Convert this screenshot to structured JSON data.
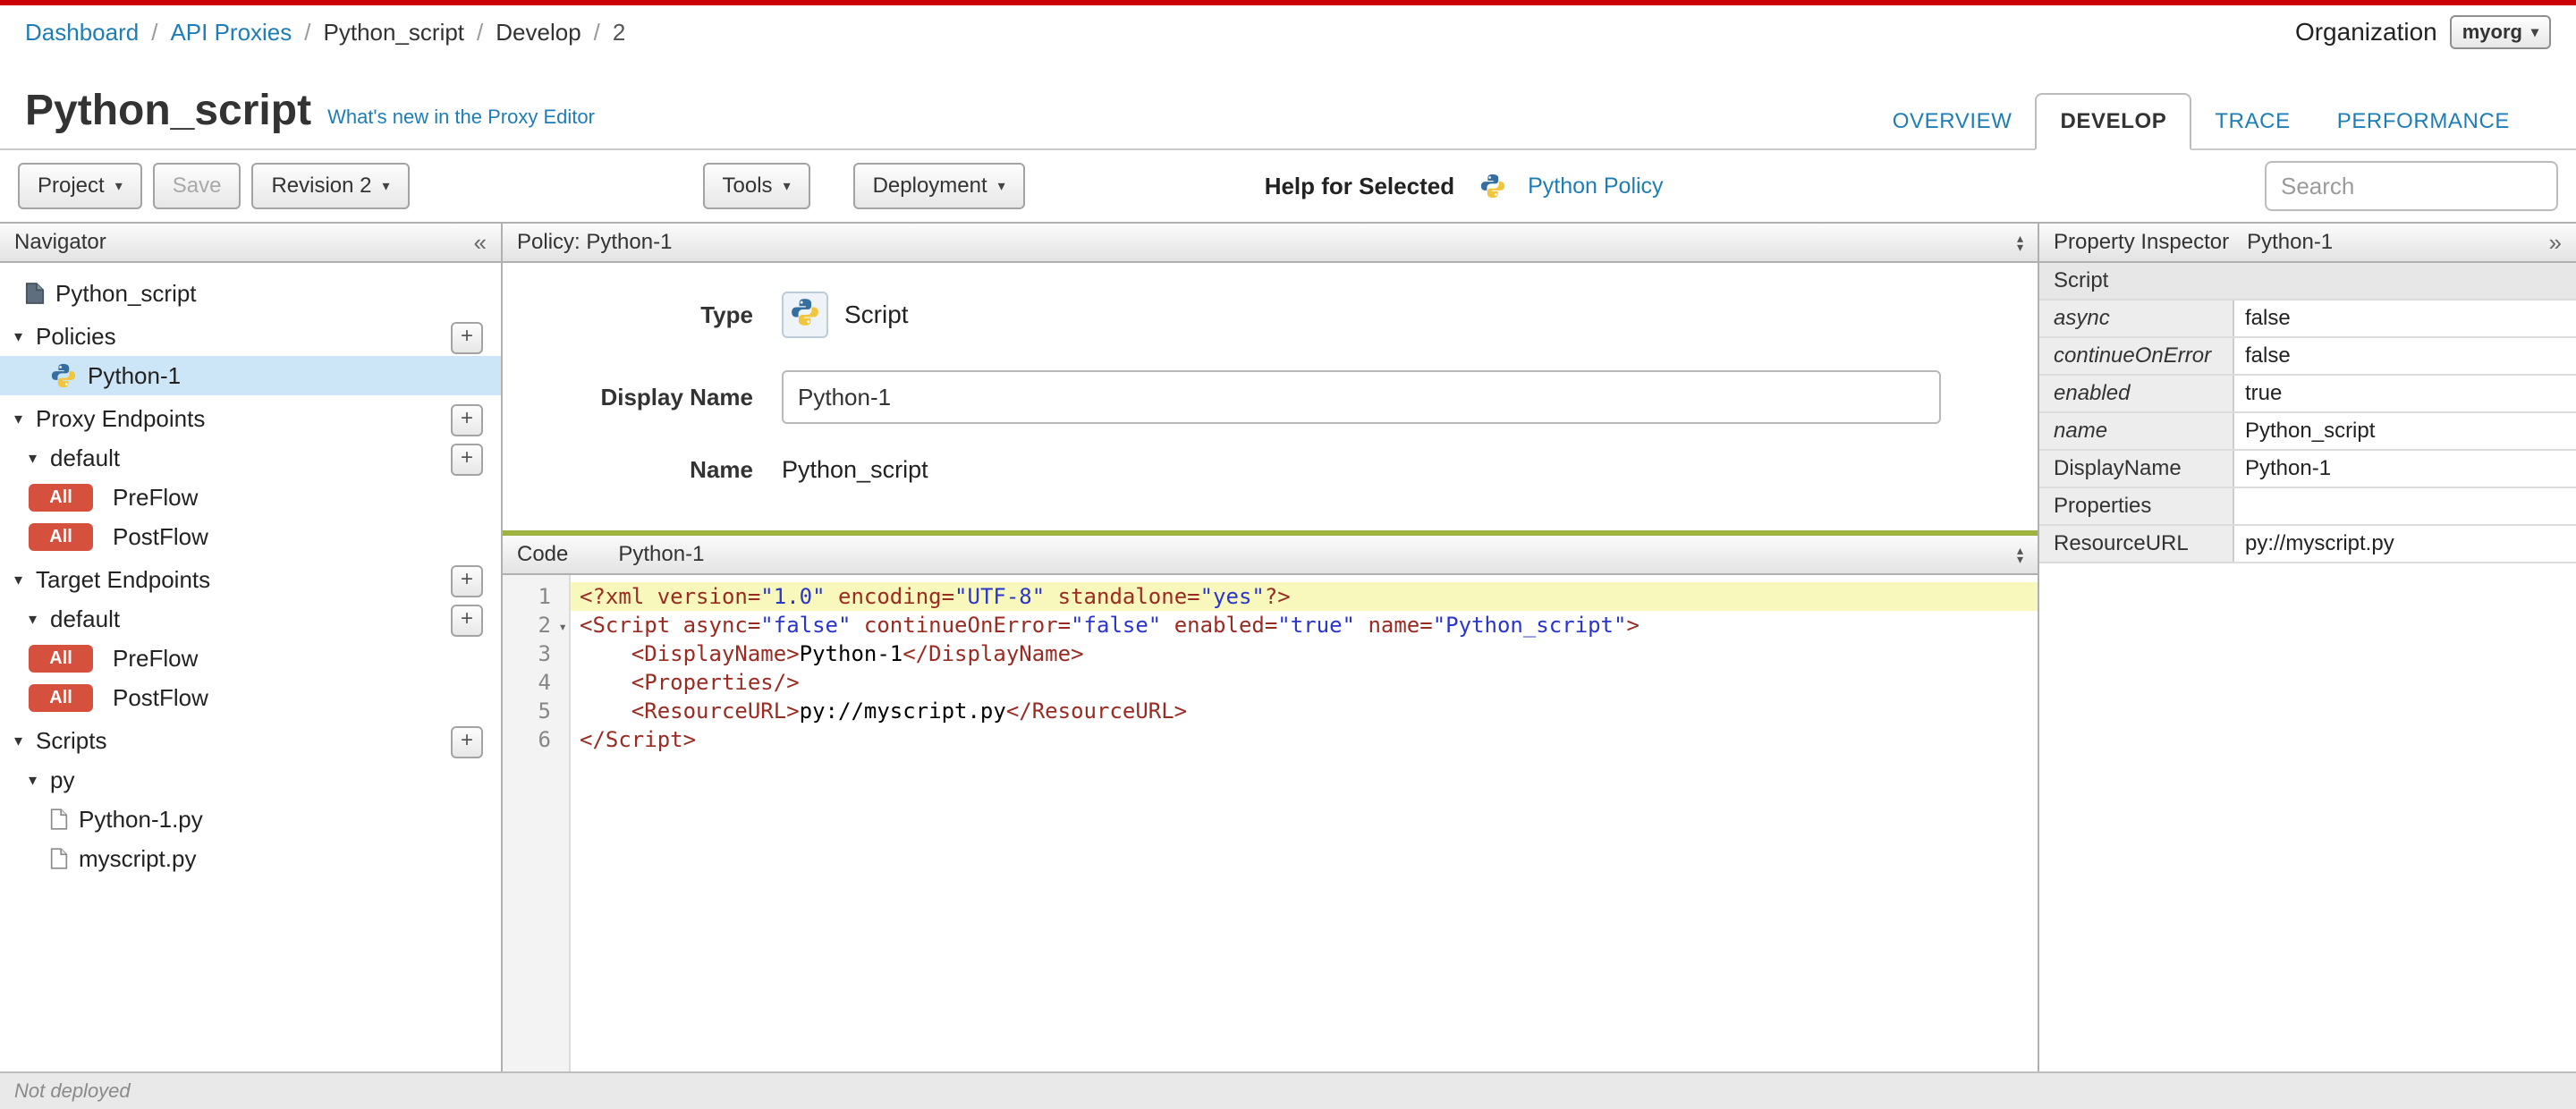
{
  "header": {
    "breadcrumb": [
      {
        "label": "Dashboard",
        "link": true
      },
      {
        "label": "API Proxies",
        "link": true
      },
      {
        "label": "Python_script",
        "link": false
      },
      {
        "label": "Develop",
        "link": false
      },
      {
        "label": "2",
        "link": false,
        "muted": true
      }
    ],
    "organization_label": "Organization",
    "organization_value": "myorg",
    "title": "Python_script",
    "whats_new_link": "What's new in the Proxy Editor",
    "tabs": [
      {
        "label": "OVERVIEW",
        "active": false
      },
      {
        "label": "DEVELOP",
        "active": true
      },
      {
        "label": "TRACE",
        "active": false
      },
      {
        "label": "PERFORMANCE",
        "active": false
      }
    ]
  },
  "toolbar": {
    "project_label": "Project",
    "save_label": "Save",
    "revision_label": "Revision 2",
    "tools_label": "Tools",
    "deployment_label": "Deployment",
    "help_for_selected_label": "Help for Selected",
    "policy_help_link": "Python Policy",
    "search_placeholder": "Search"
  },
  "navigator": {
    "title": "Navigator",
    "collapse_glyph": "«",
    "items": [
      {
        "type": "root",
        "icon": "proxy-icon",
        "label": "Python_script",
        "indent": 0
      },
      {
        "type": "section",
        "label": "Policies",
        "disclosure": true,
        "plus": true,
        "indent": 0
      },
      {
        "type": "policy",
        "icon": "python-icon",
        "label": "Python-1",
        "selected": true,
        "indent": 1
      },
      {
        "type": "section",
        "label": "Proxy Endpoints",
        "disclosure": true,
        "plus": true,
        "indent": 0
      },
      {
        "type": "subsection",
        "label": "default",
        "disclosure": true,
        "plus": true,
        "indent": 1
      },
      {
        "type": "flow",
        "badge": "All",
        "label": "PreFlow",
        "indent": 1
      },
      {
        "type": "flow",
        "badge": "All",
        "label": "PostFlow",
        "indent": 1
      },
      {
        "type": "section",
        "label": "Target Endpoints",
        "disclosure": true,
        "plus": true,
        "indent": 0
      },
      {
        "type": "subsection",
        "label": "default",
        "disclosure": true,
        "plus": true,
        "indent": 1
      },
      {
        "type": "flow",
        "badge": "All",
        "label": "PreFlow",
        "indent": 1
      },
      {
        "type": "flow",
        "badge": "All",
        "label": "PostFlow",
        "indent": 1
      },
      {
        "type": "section",
        "label": "Scripts",
        "disclosure": true,
        "plus": true,
        "indent": 0
      },
      {
        "type": "subsection",
        "label": "py",
        "disclosure": true,
        "indent": 1
      },
      {
        "type": "file",
        "icon": "file-icon",
        "label": "Python-1.py",
        "indent": 2
      },
      {
        "type": "file",
        "icon": "file-icon",
        "label": "myscript.py",
        "indent": 2
      }
    ]
  },
  "policy_panel": {
    "title": "Policy: Python-1",
    "type_label": "Type",
    "type_value": "Script",
    "display_name_label": "Display Name",
    "display_name_value": "Python-1",
    "name_label": "Name",
    "name_value": "Python_script"
  },
  "code_panel": {
    "header_label": "Code",
    "header_file": "Python-1",
    "lines": [
      {
        "num": 1,
        "active": true,
        "tokens": [
          [
            "tag",
            "<?xml "
          ],
          [
            "attr",
            "version="
          ],
          [
            "str",
            "\"1.0\""
          ],
          [
            "attr",
            " encoding="
          ],
          [
            "str",
            "\"UTF-8\""
          ],
          [
            "attr",
            " standalone="
          ],
          [
            "str",
            "\"yes\""
          ],
          [
            "tag",
            "?>"
          ]
        ]
      },
      {
        "num": 2,
        "fold": true,
        "tokens": [
          [
            "tag",
            "<Script "
          ],
          [
            "attr",
            "async="
          ],
          [
            "str",
            "\"false\""
          ],
          [
            "attr",
            " continueOnError="
          ],
          [
            "str",
            "\"false\""
          ],
          [
            "attr",
            " enabled="
          ],
          [
            "str",
            "\"true\""
          ],
          [
            "attr",
            " name="
          ],
          [
            "str",
            "\"Python_script\""
          ],
          [
            "tag",
            ">"
          ]
        ]
      },
      {
        "num": 3,
        "tokens": [
          [
            "txt",
            "    "
          ],
          [
            "tag",
            "<DisplayName>"
          ],
          [
            "txt",
            "Python-1"
          ],
          [
            "tag",
            "</DisplayName>"
          ]
        ]
      },
      {
        "num": 4,
        "tokens": [
          [
            "txt",
            "    "
          ],
          [
            "tag",
            "<Properties/>"
          ]
        ]
      },
      {
        "num": 5,
        "tokens": [
          [
            "txt",
            "    "
          ],
          [
            "tag",
            "<ResourceURL>"
          ],
          [
            "txt",
            "py://myscript.py"
          ],
          [
            "tag",
            "</ResourceURL>"
          ]
        ]
      },
      {
        "num": 6,
        "tokens": [
          [
            "tag",
            "</Script>"
          ]
        ]
      }
    ]
  },
  "inspector": {
    "title": "Property Inspector",
    "subject": "Python-1",
    "expand_glyph": "»",
    "rows": [
      {
        "kind": "section",
        "name": "Script"
      },
      {
        "kind": "pair",
        "name": "async",
        "italic": true,
        "value": "false"
      },
      {
        "kind": "pair",
        "name": "continueOnError",
        "italic": true,
        "value": "false"
      },
      {
        "kind": "pair",
        "name": "enabled",
        "italic": true,
        "value": "true"
      },
      {
        "kind": "pair",
        "name": "name",
        "italic": true,
        "value": "Python_script"
      },
      {
        "kind": "pair",
        "name": "DisplayName",
        "italic": false,
        "value": "Python-1"
      },
      {
        "kind": "pair",
        "name": "Properties",
        "italic": false,
        "value": ""
      },
      {
        "kind": "pair",
        "name": "ResourceURL",
        "italic": false,
        "value": "py://myscript.py"
      }
    ]
  },
  "statusbar": {
    "text": "Not deployed"
  },
  "colors": {
    "accent_red": "#cc0001",
    "link_blue": "#1f7db6",
    "selected_row": "#cde6f7",
    "badge_red": "#d6503e",
    "code_divider_green": "#9fb440"
  }
}
